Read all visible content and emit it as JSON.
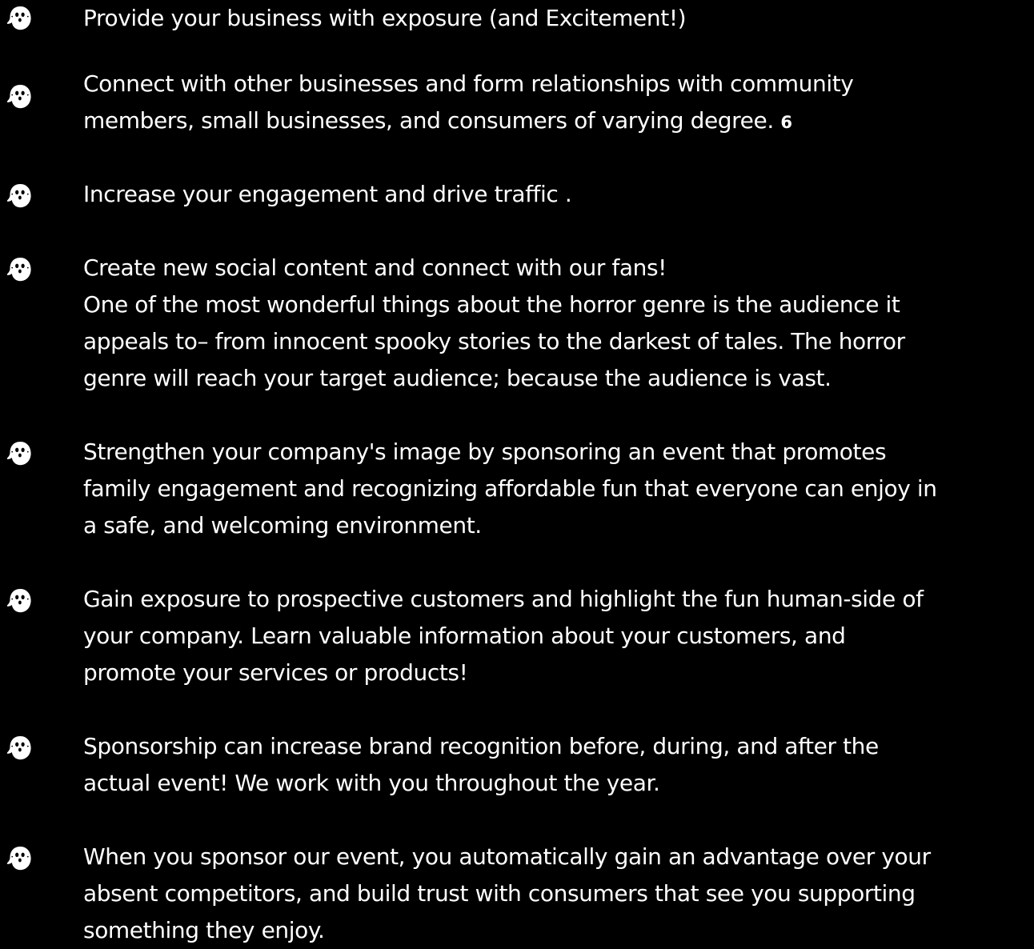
{
  "colors": {
    "background": "#000000",
    "text": "#ffffff",
    "icon": "#ffffff"
  },
  "icon_name": "ghost-icon",
  "items": [
    {
      "lines": [
        "Provide your business with exposure (and Excitement!)"
      ]
    },
    {
      "lines": [
        "Connect with other businesses and form relationships with community",
        "members, small businesses, and consumers of varying degree."
      ],
      "ref": "6"
    },
    {
      "lines": [
        "Increase your engagement and drive traffic ."
      ]
    },
    {
      "lines": [
        "Create new social content and connect with our fans!",
        "One of the most wonderful things about the horror genre is the audience it",
        "appeals to– from innocent spooky stories to the darkest of tales. The horror",
        "genre will reach your target audience; because the audience is vast."
      ]
    },
    {
      "lines": [
        "Strengthen your company's image by sponsoring an event that promotes",
        "family engagement and recognizing affordable fun that everyone can enjoy in",
        "a safe, and welcoming environment."
      ]
    },
    {
      "lines": [
        "Gain exposure to prospective customers and highlight the fun human-side of",
        "your company. Learn valuable information about your customers, and",
        "promote your services or products!"
      ]
    },
    {
      "lines": [
        "Sponsorship can increase brand recognition before, during, and after the",
        "actual event! We work with you throughout the year."
      ]
    },
    {
      "lines": [
        "When you sponsor our event, you automatically gain an advantage over your",
        "absent competitors, and build trust with consumers that see you supporting",
        "something they enjoy."
      ]
    }
  ]
}
